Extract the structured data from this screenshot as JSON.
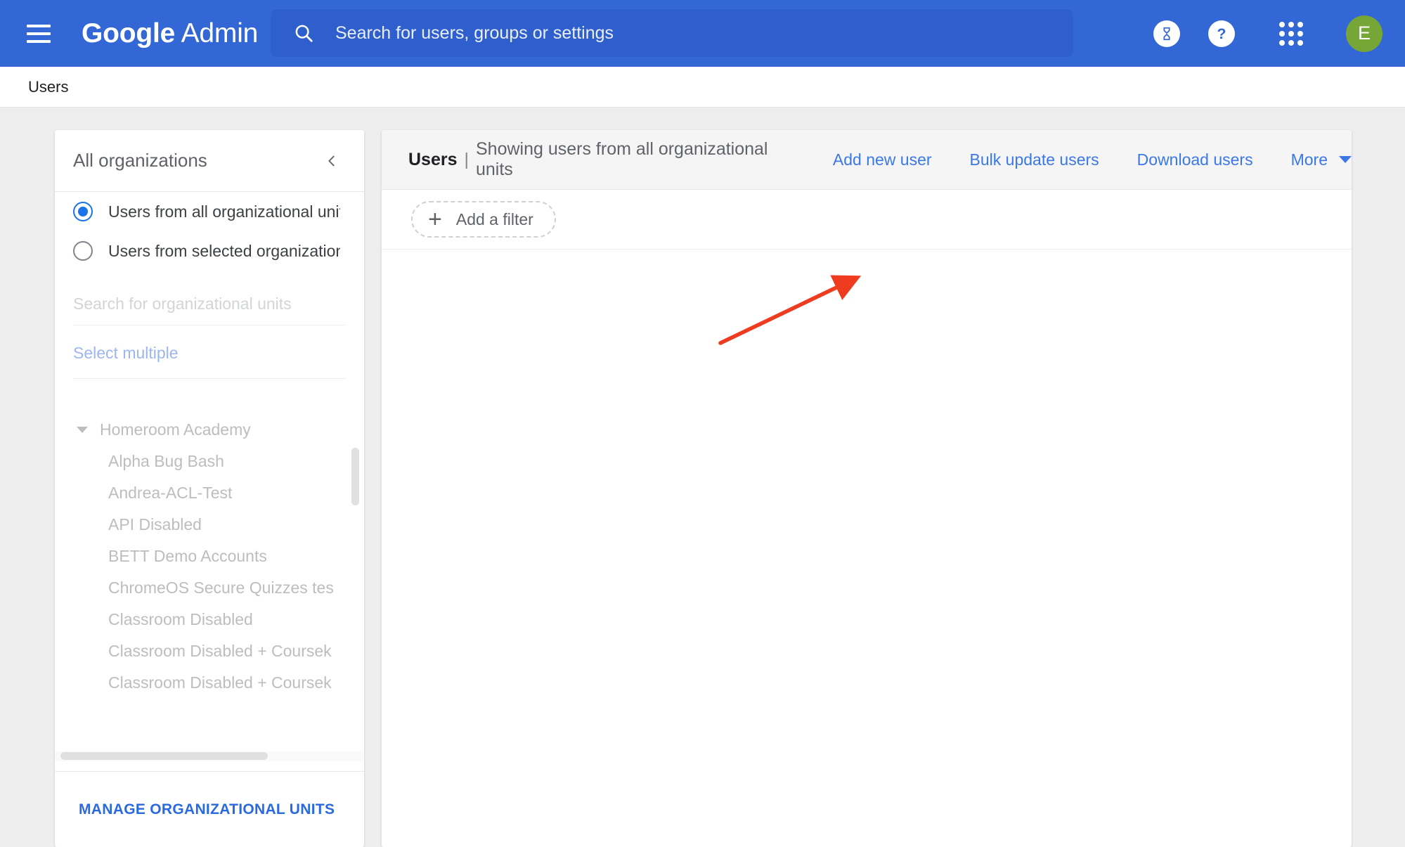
{
  "appbar": {
    "menu_icon": "hamburger-menu-icon",
    "brand_bold": "Google",
    "brand_light": " Admin",
    "search": {
      "icon": "search-icon",
      "placeholder": "Search for users, groups or settings",
      "value": ""
    },
    "icons": [
      {
        "name": "hourglass-icon",
        "glyph": "⧖"
      },
      {
        "name": "help-icon",
        "glyph": "?"
      },
      {
        "name": "apps-grid-icon",
        "glyph": "grid-9-dots"
      }
    ],
    "avatar": {
      "name": "account-avatar",
      "initial": "E",
      "color": "#76a736"
    }
  },
  "breadcrumb": {
    "label": "Users"
  },
  "sidebar": {
    "title": "All organizations",
    "collapse_icon": "chevron-left-icon",
    "radios": [
      {
        "label": "Users from all organizational units",
        "selected": true
      },
      {
        "label": "Users from selected organizational…",
        "selected": false
      }
    ],
    "search_placeholder": "Search for organizational units",
    "search_value": "",
    "select_multiple": "Select multiple",
    "org_units": [
      {
        "label": "Homeroom Academy",
        "level": 0,
        "expanded": true
      },
      {
        "label": "Alpha Bug Bash",
        "level": 1
      },
      {
        "label": "Andrea-ACL-Test",
        "level": 1
      },
      {
        "label": "API Disabled",
        "level": 1
      },
      {
        "label": "BETT Demo Accounts",
        "level": 1
      },
      {
        "label": "ChromeOS Secure Quizzes tes",
        "level": 1
      },
      {
        "label": "Classroom Disabled",
        "level": 1
      },
      {
        "label": "Classroom Disabled + Coursek",
        "level": 1
      },
      {
        "label": "Classroom Disabled + Coursek",
        "level": 1
      }
    ],
    "manage_button": "MANAGE ORGANIZATIONAL UNITS"
  },
  "main": {
    "header": {
      "title": "Users",
      "separator": "|",
      "subtitle": "Showing users from all organizational units"
    },
    "actions": [
      {
        "label": "Add new user",
        "name": "add-new-user-link"
      },
      {
        "label": "Bulk update users",
        "name": "bulk-update-users-link"
      },
      {
        "label": "Download users",
        "name": "download-users-link"
      },
      {
        "label": "More",
        "name": "more-actions-link",
        "has_caret": true
      }
    ],
    "filter": {
      "label": "Add a filter",
      "icon": "plus-icon"
    }
  },
  "annotation": {
    "arrow_color": "#ef3b1f",
    "points_to": "Add new user"
  },
  "colors": {
    "appbar_blue": "#3367d6",
    "search_blue": "#2f5fcd",
    "link_blue": "#3b78e7",
    "page_bg": "#eeeeee",
    "accent": "#1a73e8"
  }
}
